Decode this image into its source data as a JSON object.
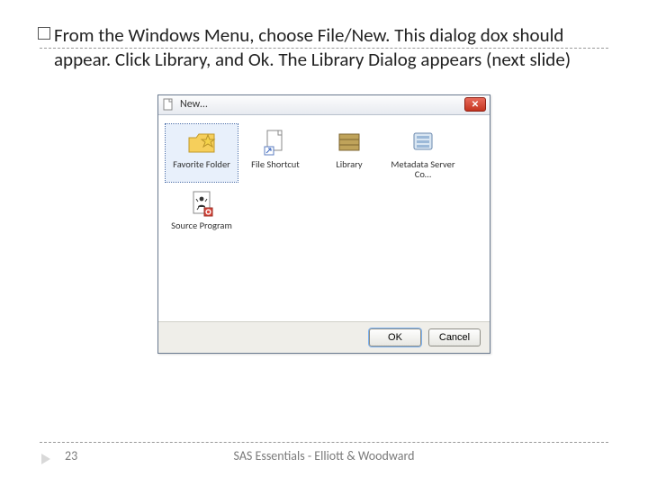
{
  "body_text": "From the Windows Menu, choose File/New. This dialog dox should appear. Click Library, and Ok. The Library Dialog appears (next slide)",
  "dialog": {
    "title": "New…",
    "items": [
      {
        "label": "Favorite Folder",
        "selected": true,
        "icon": "favorite-folder"
      },
      {
        "label": "File Shortcut",
        "selected": false,
        "icon": "file-shortcut"
      },
      {
        "label": "Library",
        "selected": false,
        "icon": "library"
      },
      {
        "label": "Metadata Server Co…",
        "selected": false,
        "icon": "metadata-server"
      },
      {
        "label": "Source Program",
        "selected": false,
        "icon": "source-program"
      }
    ],
    "ok": "OK",
    "cancel": "Cancel"
  },
  "page_number": "23",
  "footer": "SAS Essentials - Elliott & Woodward"
}
